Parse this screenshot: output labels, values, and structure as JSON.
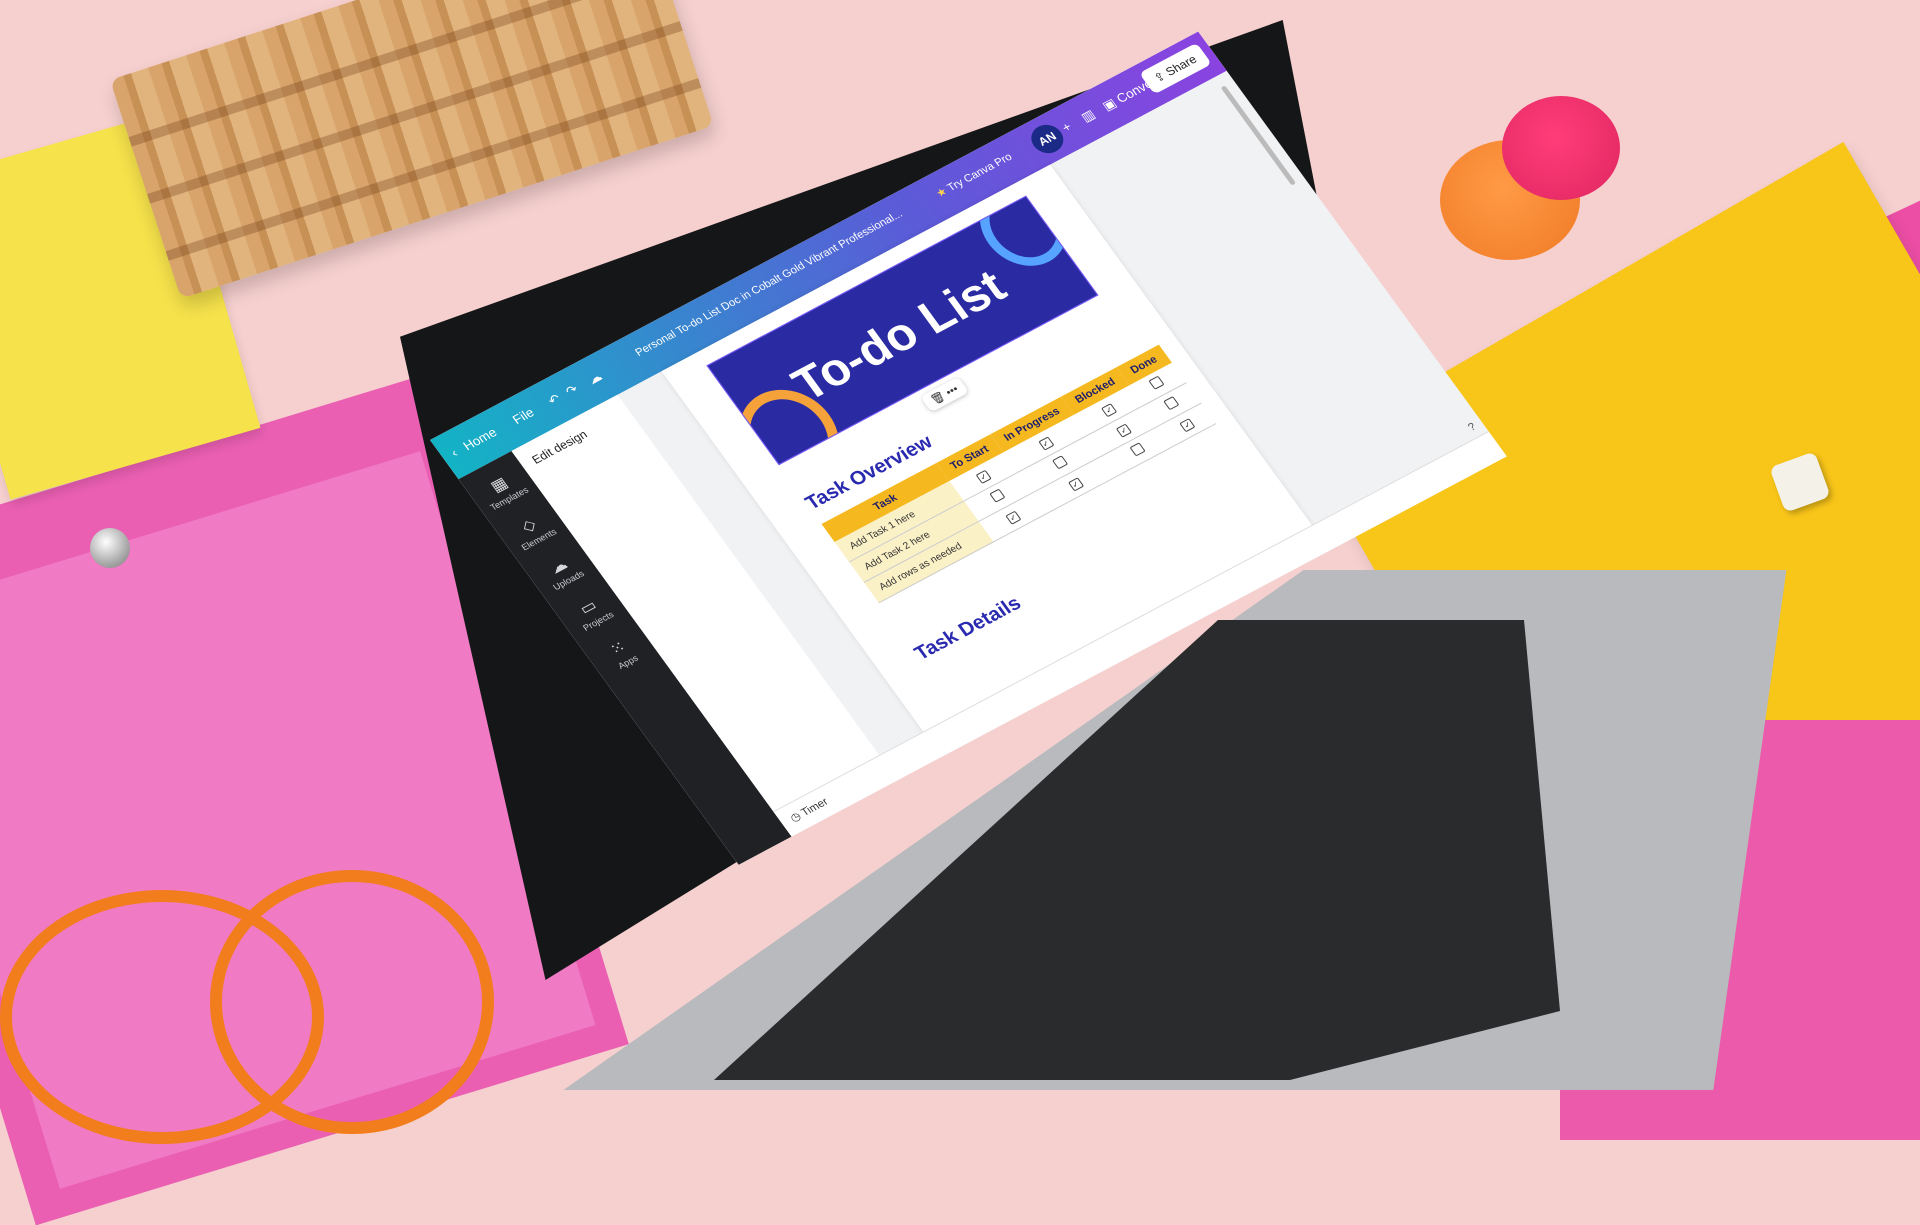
{
  "scene": {
    "colors": {
      "desk": "#f6d0cf",
      "pink": "#ea5fb2",
      "yellow": "#f8c519",
      "canva_purple": "#8a43e0",
      "canva_teal": "#13b3c5",
      "banner_blue": "#2a2aa3",
      "table_yellow": "#f5b91f"
    }
  },
  "topbar": {
    "back_icon": "chevron-left-icon",
    "home": "Home",
    "file": "File",
    "doc_title": "Personal To-do List Doc in Cobalt Gold Vibrant Professional...",
    "try_pro": "Try Canva Pro",
    "avatar": "AN",
    "convert": "Convert",
    "share": "Share"
  },
  "sidebar": {
    "items": [
      {
        "label": "Templates",
        "icon": "templates-icon"
      },
      {
        "label": "Elements",
        "icon": "elements-icon"
      },
      {
        "label": "Uploads",
        "icon": "upload-cloud-icon"
      },
      {
        "label": "Projects",
        "icon": "folder-icon"
      },
      {
        "label": "Apps",
        "icon": "apps-grid-icon"
      }
    ]
  },
  "panel": {
    "title": "Edit design"
  },
  "document": {
    "banner_title": "To-do List",
    "section1": "Task Overview",
    "section2": "Task Details",
    "columns": [
      "Task",
      "To Start",
      "In Progress",
      "Blocked",
      "Done"
    ],
    "rows": [
      {
        "task": "Add Task 1 here",
        "checks": [
          true,
          true,
          true,
          false
        ]
      },
      {
        "task": "Add Task 2 here",
        "checks": [
          false,
          false,
          true,
          false
        ]
      },
      {
        "task": "Add rows as needed",
        "checks": [
          true,
          true,
          false,
          true
        ]
      }
    ]
  },
  "bottombar": {
    "timer": "Timer"
  }
}
